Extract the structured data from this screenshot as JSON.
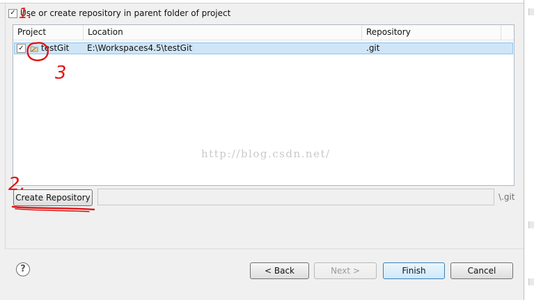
{
  "top_checkbox": {
    "checked": true,
    "label": "Use or create repository in parent folder of project"
  },
  "table": {
    "columns": [
      "Project",
      "Location",
      "Repository"
    ],
    "rows": [
      {
        "checked": true,
        "project": "testGit",
        "location": "E:\\Workspaces4.5\\testGit",
        "repository": ".git"
      }
    ]
  },
  "watermark": "http://blog.csdn.net/",
  "create_repository": {
    "label": "Create Repository",
    "input_value": "",
    "suffix": "\\.git"
  },
  "buttons": {
    "back": "< Back",
    "next": "Next >",
    "finish": "Finish",
    "cancel": "Cancel"
  },
  "annotations": {
    "mark_1_top": "1.",
    "mark_2": "2.",
    "mark_3": "3"
  },
  "colors": {
    "annotation_red": "#e01515",
    "selection": "#cfe6f9",
    "default_button": "#3c7fb1"
  }
}
